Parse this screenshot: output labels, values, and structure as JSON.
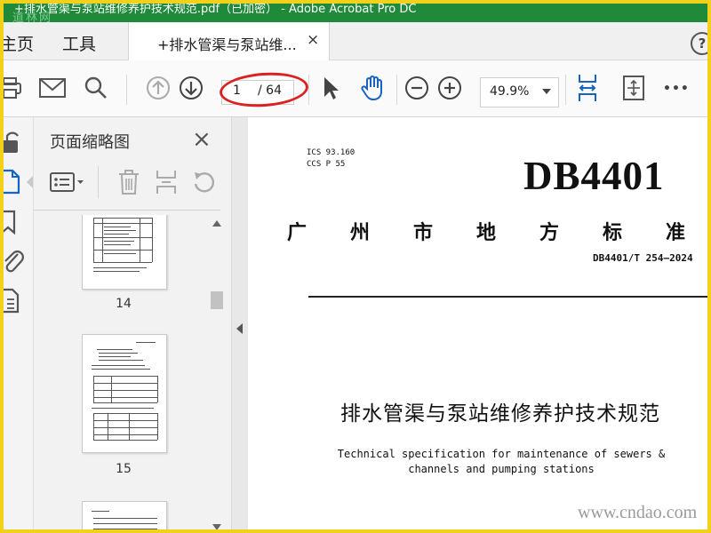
{
  "window": {
    "title": "+排水管渠与泵站维修养护技术规范.pdf（已加密） - Adobe Acrobat Pro DC",
    "watermark_tl": "道林网"
  },
  "menubar": {
    "home": "主页",
    "tools": "工具",
    "tab_label": "+排水管渠与泵站维...",
    "tab_close": "×",
    "help": "?"
  },
  "toolbar": {
    "icons": [
      "print-icon",
      "mail-icon",
      "search-icon",
      "page-up-icon",
      "page-down-icon",
      "select-arrow-icon",
      "hand-icon",
      "zoom-out-icon",
      "zoom-in-icon",
      "fit-width-icon",
      "full-screen-icon",
      "more-icon"
    ],
    "page_current": "1",
    "page_total": "/ 64",
    "zoom": "49.9%",
    "more": "•••",
    "accent": "#1565c0"
  },
  "rail": {
    "icons": [
      "lock-icon",
      "pages-icon",
      "bookmark-icon",
      "attachment-icon",
      "document-icon"
    ]
  },
  "panel": {
    "title": "页面缩略图",
    "close": "×",
    "thumbnails": [
      {
        "label": "14"
      },
      {
        "label": "15"
      }
    ]
  },
  "document": {
    "ics": "ICS 93.160",
    "ccs": "CCS P 55",
    "big_code": "DB4401",
    "local_standard_chars": [
      "广",
      "州",
      "市",
      "地",
      "方",
      "标",
      "准"
    ],
    "std_code": "DB4401/T 254—2024",
    "title_cn": "排水管渠与泵站维修养护技术规范",
    "title_en_1": "Technical specification for maintenance of sewers &",
    "title_en_2": "channels and pumping stations"
  },
  "watermark": "www.cndao.com"
}
